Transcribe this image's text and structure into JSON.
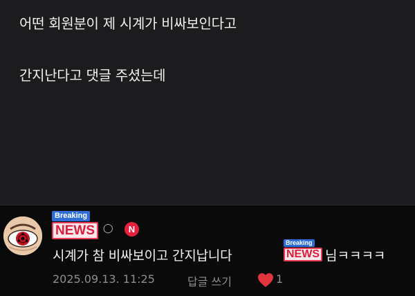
{
  "post": {
    "line1": "어떤 회원분이 제 시계가 비싸보인다고",
    "line2": "간지난다고 댓글 주셨는데"
  },
  "comment": {
    "badge_top": "Breaking",
    "badge_main": "NEWS",
    "n_badge": "N",
    "text": "시계가 참 비싸보이고 간지납니다",
    "mention_badge_top": "Breaking",
    "mention_badge_main": "NEWS",
    "mention_suffix": "님ㅋㅋㅋㅋ",
    "date": "2025.09.13. 11:25",
    "reply_label": "답글 쓰기",
    "like_count": "1"
  },
  "colors": {
    "post_background": "#1c1c1e",
    "page_background": "#0a0a0a",
    "like_heart": "#e0353f",
    "n_badge": "#e3203d",
    "news_red": "#d81e3a",
    "breaking_blue": "#2d6fd6"
  },
  "icons": {
    "avatar": "sharingan-eye-avatar",
    "heart": "heart-icon",
    "medal": "medal-icon"
  }
}
